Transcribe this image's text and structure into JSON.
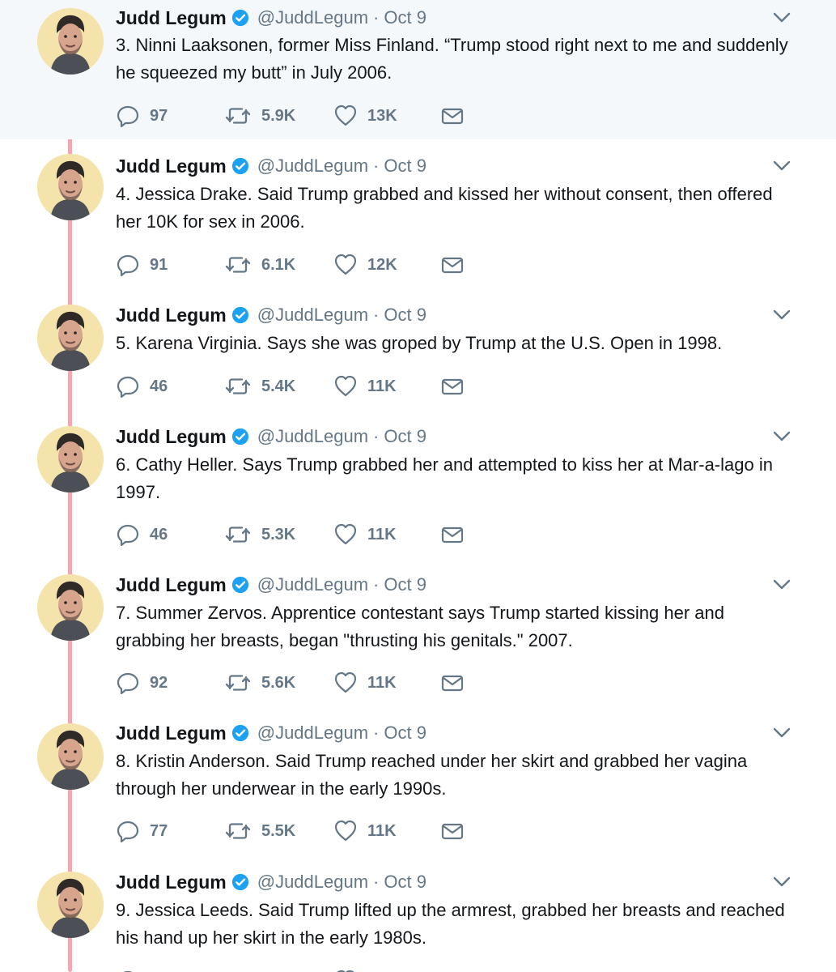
{
  "tweets": [
    {
      "author": "Judd Legum",
      "handle": "@JuddLegum",
      "separator": "·",
      "date": "Oct 9",
      "text": "3. Ninni Laaksonen, former Miss Finland. “Trump stood right next to me and suddenly he squeezed my butt” in July 2006.",
      "replies": "97",
      "retweets": "5.9K",
      "likes": "13K"
    },
    {
      "author": "Judd Legum",
      "handle": "@JuddLegum",
      "separator": "·",
      "date": "Oct 9",
      "text": "4. Jessica Drake. Said Trump grabbed and kissed her without consent, then offered her 10K for sex in 2006.",
      "replies": "91",
      "retweets": "6.1K",
      "likes": "12K"
    },
    {
      "author": "Judd Legum",
      "handle": "@JuddLegum",
      "separator": "·",
      "date": "Oct 9",
      "text": "5. Karena Virginia. Says she was groped by Trump at the U.S. Open in 1998.",
      "replies": "46",
      "retweets": "5.4K",
      "likes": "11K"
    },
    {
      "author": "Judd Legum",
      "handle": "@JuddLegum",
      "separator": "·",
      "date": "Oct 9",
      "text": "6. Cathy Heller. Says Trump grabbed her and attempted to kiss her at Mar-a-lago in 1997.",
      "replies": "46",
      "retweets": "5.3K",
      "likes": "11K"
    },
    {
      "author": "Judd Legum",
      "handle": "@JuddLegum",
      "separator": "·",
      "date": "Oct 9",
      "text": "7. Summer Zervos. Apprentice contestant says Trump started kissing her and grabbing her breasts, began \"thrusting his genitals.\" 2007.",
      "replies": "92",
      "retweets": "5.6K",
      "likes": "11K"
    },
    {
      "author": "Judd Legum",
      "handle": "@JuddLegum",
      "separator": "·",
      "date": "Oct 9",
      "text": "8. Kristin Anderson. Said Trump reached under her skirt and grabbed her vagina through her underwear in the early 1990s.",
      "replies": "77",
      "retweets": "5.5K",
      "likes": "11K"
    },
    {
      "author": "Judd Legum",
      "handle": "@JuddLegum",
      "separator": "·",
      "date": "Oct 9",
      "text": "9. Jessica Leeds. Said Trump lifted up the armrest, grabbed her breasts and reached his hand up her skirt in the early 1980s.",
      "replies": "",
      "retweets": "",
      "likes": ""
    }
  ],
  "icons": {
    "reply": "reply-icon",
    "retweet": "retweet-icon",
    "like": "heart-icon",
    "mail": "mail-icon",
    "verified": "verified-badge-icon",
    "chevron": "chevron-down-icon"
  },
  "colors": {
    "thread_line": "#f2a8b1",
    "highlight_background": "#f5f8fa",
    "verified": "#1da1f2",
    "muted_text": "#657786"
  }
}
